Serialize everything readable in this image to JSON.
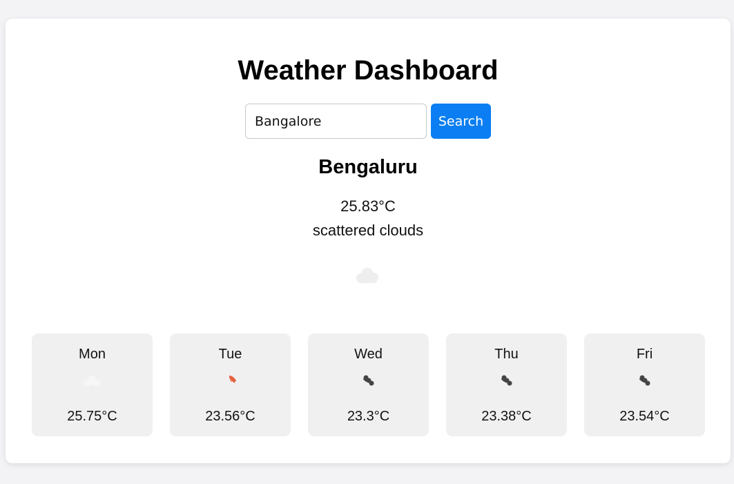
{
  "header": {
    "title": "Weather Dashboard"
  },
  "search": {
    "value": "Bangalore",
    "button_label": "Search"
  },
  "current": {
    "city": "Bengaluru",
    "temperature": "25.83°C",
    "description": "scattered clouds",
    "icon": "scattered-clouds-icon"
  },
  "forecast": [
    {
      "day": "Mon",
      "temp": "25.75°C",
      "icon": "few-clouds-day-icon"
    },
    {
      "day": "Tue",
      "temp": "23.56°C",
      "icon": "rain-day-icon"
    },
    {
      "day": "Wed",
      "temp": "23.3°C",
      "icon": "broken-clouds-icon"
    },
    {
      "day": "Thu",
      "temp": "23.38°C",
      "icon": "broken-clouds-icon"
    },
    {
      "day": "Fri",
      "temp": "23.54°C",
      "icon": "broken-clouds-icon"
    }
  ],
  "colors": {
    "accent": "#0a7ef2",
    "page_background": "#f3f3f6",
    "card_background": "#ffffff",
    "forecast_card_background": "#f0f0f0"
  }
}
